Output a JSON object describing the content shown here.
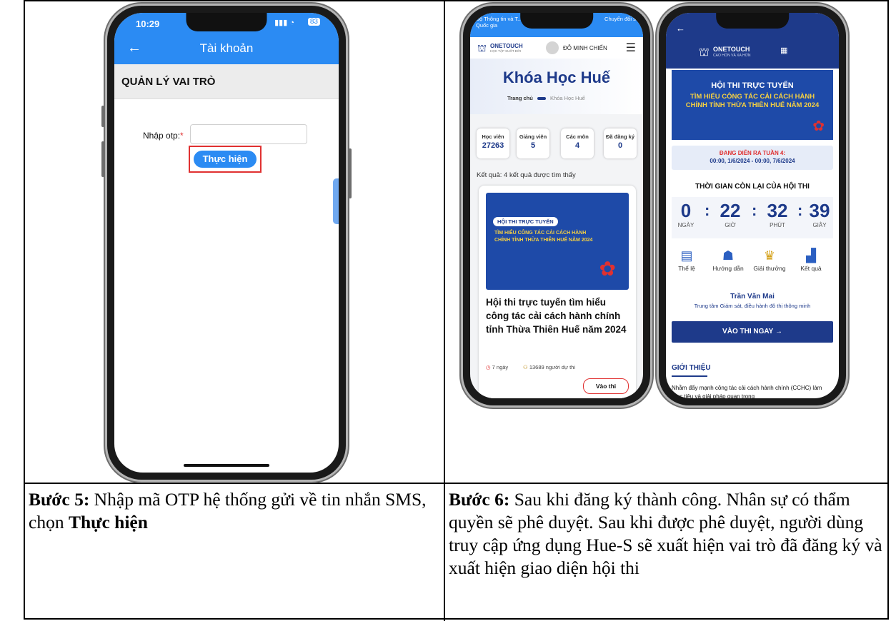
{
  "left": {
    "phone": {
      "time": "10:29",
      "battery": "83",
      "title": "Tài khoản",
      "section": "QUẢN LÝ VAI TRÒ",
      "otp_label": "Nhập otp:",
      "required": "*",
      "submit": "Thực hiện"
    },
    "caption": {
      "step": "Bước 5:",
      "text1": " Nhập mã OTP hệ thống gửi về tin nhắn SMS, chọn ",
      "bold": "Thực hiện"
    }
  },
  "middle": {
    "status_left": "Bộ Thông tin và T... Quốc gia",
    "status_right": "Chuyển đổi số",
    "brand": "ONETOUCH",
    "brand_sub": "HỌC TẬP SUỐT ĐỜI",
    "user": "ĐỖ MINH CHIẾN",
    "page_title": "Khóa Học Huế",
    "crumb_home": "Trang chủ",
    "crumb_current": "Khóa Học Huế",
    "stats": [
      {
        "label": "Học viên",
        "value": "27263"
      },
      {
        "label": "Giảng viên",
        "value": "5"
      },
      {
        "label": "Các môn",
        "value": "4"
      },
      {
        "label": "Đã đăng ký",
        "value": "0"
      }
    ],
    "result": "Kết quả: 4 kết quả được tìm thấy",
    "banner_tag": "HỘI THI TRỰC TUYẾN",
    "banner_text": "TÌM HIỂU CÔNG TÁC CẢI CÁCH HÀNH CHÍNH TỈNH THỪA THIÊN HUẾ NĂM 2024",
    "card_title": "Hội thi trực tuyến tìm hiểu công tác cải cách hành chính tỉnh Thừa Thiên Huế năm 2024",
    "days": "7 ngày",
    "participants": "13689 người dự thi",
    "enter": "Vào thi"
  },
  "right": {
    "brand": "ONETOUCH",
    "brand_sub": "CAO HƠN VÀ XA HƠN",
    "banner_title": "HỘI THI TRỰC TUYẾN",
    "banner_text": "TÌM HIỂU CÔNG TÁC CẢI CÁCH HÀNH CHÍNH TỈNH THỪA THIÊN HUẾ NĂM 2024",
    "week": "ĐANG DIỄN RA TUẦN 4:",
    "week_range": "00:00, 1/6/2024 - 00:00, 7/6/2024",
    "remaining": "THỜI GIAN CÒN LẠI CỦA HỘI THI",
    "countdown": [
      {
        "n": "0",
        "u": "NGÀY"
      },
      {
        "n": "22",
        "u": "GIỜ"
      },
      {
        "n": "32",
        "u": "PHÚT"
      },
      {
        "n": "39",
        "u": "GIÂY"
      }
    ],
    "menu": [
      "Thể lệ",
      "Hướng dẫn",
      "Giải thưởng",
      "Kết quả"
    ],
    "person": "Trần Văn Mai",
    "org": "Trung tâm Giám sát, điều hành đô thị thông minh",
    "cta": "VÀO THI NGAY →",
    "intro": "GIỚI THIỆU",
    "intro_text": "Nhằm đẩy mạnh công tác cải cách hành chính (CCHC) làm mục tiêu và giải pháp quan trọng"
  },
  "caption6": {
    "step": "Bước 6:",
    "text": " Sau khi đăng ký thành công. Nhân sự có thẩm quyền sẽ phê duyệt. Sau khi được phê duyệt, người dùng truy cập ứng dụng Hue-S sẽ xuất hiện vai trò đã đăng ký và xuất hiện giao diện hội thi"
  }
}
